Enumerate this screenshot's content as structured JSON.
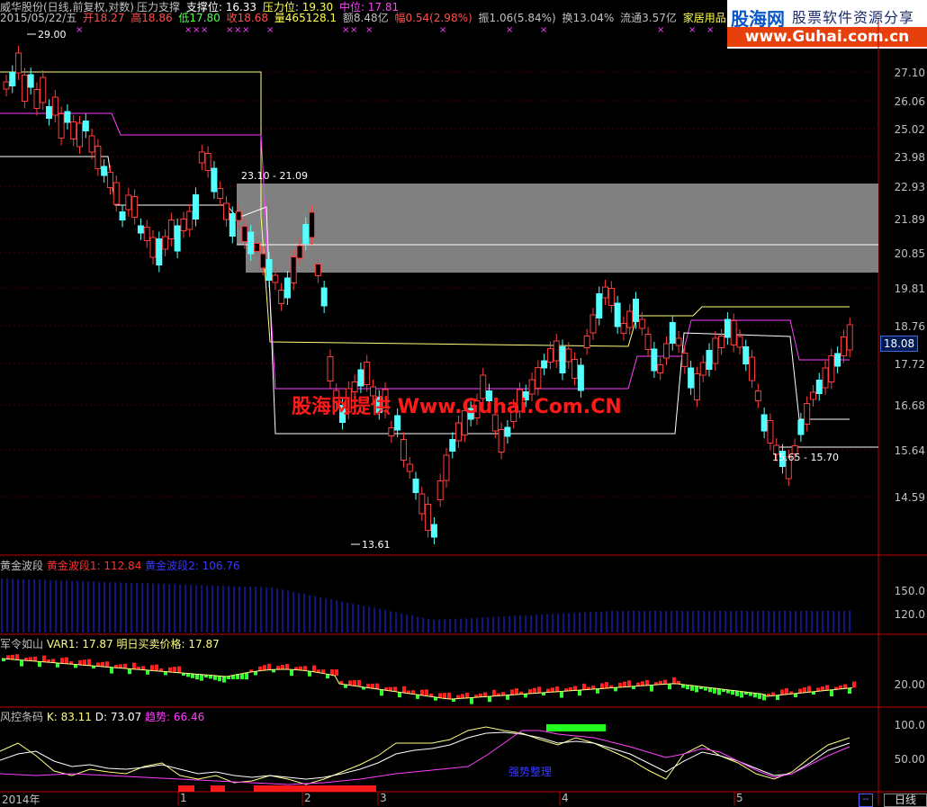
{
  "header": {
    "stock": "威华股份(日线,前复权,对数)",
    "indicator": "压力支撑",
    "support_label": "支撑位: 16.33",
    "pressure_label": "压力位: 19.30",
    "middle_label": "中位: 17.81",
    "date": "2015/05/22/五",
    "open": "开18.27",
    "high": "高18.86",
    "low": "低17.80",
    "close": "收18.68",
    "volume": "量465128.1",
    "amount": "额8.48亿",
    "change": "幅0.54(2.98%)",
    "amplitude": "振1.06(5.84%)",
    "turnover": "换13.04%",
    "float": "流通3.57亿",
    "sector": "家居用品"
  },
  "logo": {
    "name": "股海网",
    "slogan": "股票软件资源分享",
    "url": "www.Guhai.com.cn"
  },
  "watermark": "股海网提供 Www.Guhai.Com.CN",
  "price_axis": [
    "27.10",
    "26.06",
    "25.02",
    "23.98",
    "22.93",
    "21.89",
    "20.85",
    "19.81",
    "18.76",
    "17.72",
    "16.68",
    "15.64",
    "14.59"
  ],
  "current_price": "18.08",
  "annotations": {
    "high_point": "29.00",
    "low_point": "13.61",
    "zone_top": "23.10 - 21.09",
    "zone_bottom": "15.65 - 15.70"
  },
  "indicators": {
    "wave": {
      "name": "黄金波段",
      "v1": "黄金波段1: 112.84",
      "v2": "黄金波段2: 106.76",
      "ticks": [
        "150.0",
        "120.0"
      ]
    },
    "army": {
      "name": "军令如山",
      "var1": "VAR1: 17.87",
      "next": "明日买卖价格: 17.87",
      "ticks": [
        "20.00"
      ]
    },
    "risk": {
      "name": "风控条码",
      "k": "K: 83.11",
      "d": "D: 73.07",
      "trend": "趋势: 66.46",
      "ticks": [
        "100.0",
        "50.00"
      ],
      "note": "强势整理"
    }
  },
  "x_axis": {
    "dates": [
      "2014年",
      "1",
      "2",
      "3",
      "4",
      "5"
    ]
  },
  "period_button": "日线",
  "colors": {
    "up": "#ff3c3c",
    "down": "#54ffff",
    "pressure": "#ffff80",
    "support": "#ffffff",
    "middle": "#ff40ff",
    "zone": "#808080"
  },
  "candles": [
    [
      18.27,
      18.86,
      17.8,
      18.68
    ]
  ]
}
